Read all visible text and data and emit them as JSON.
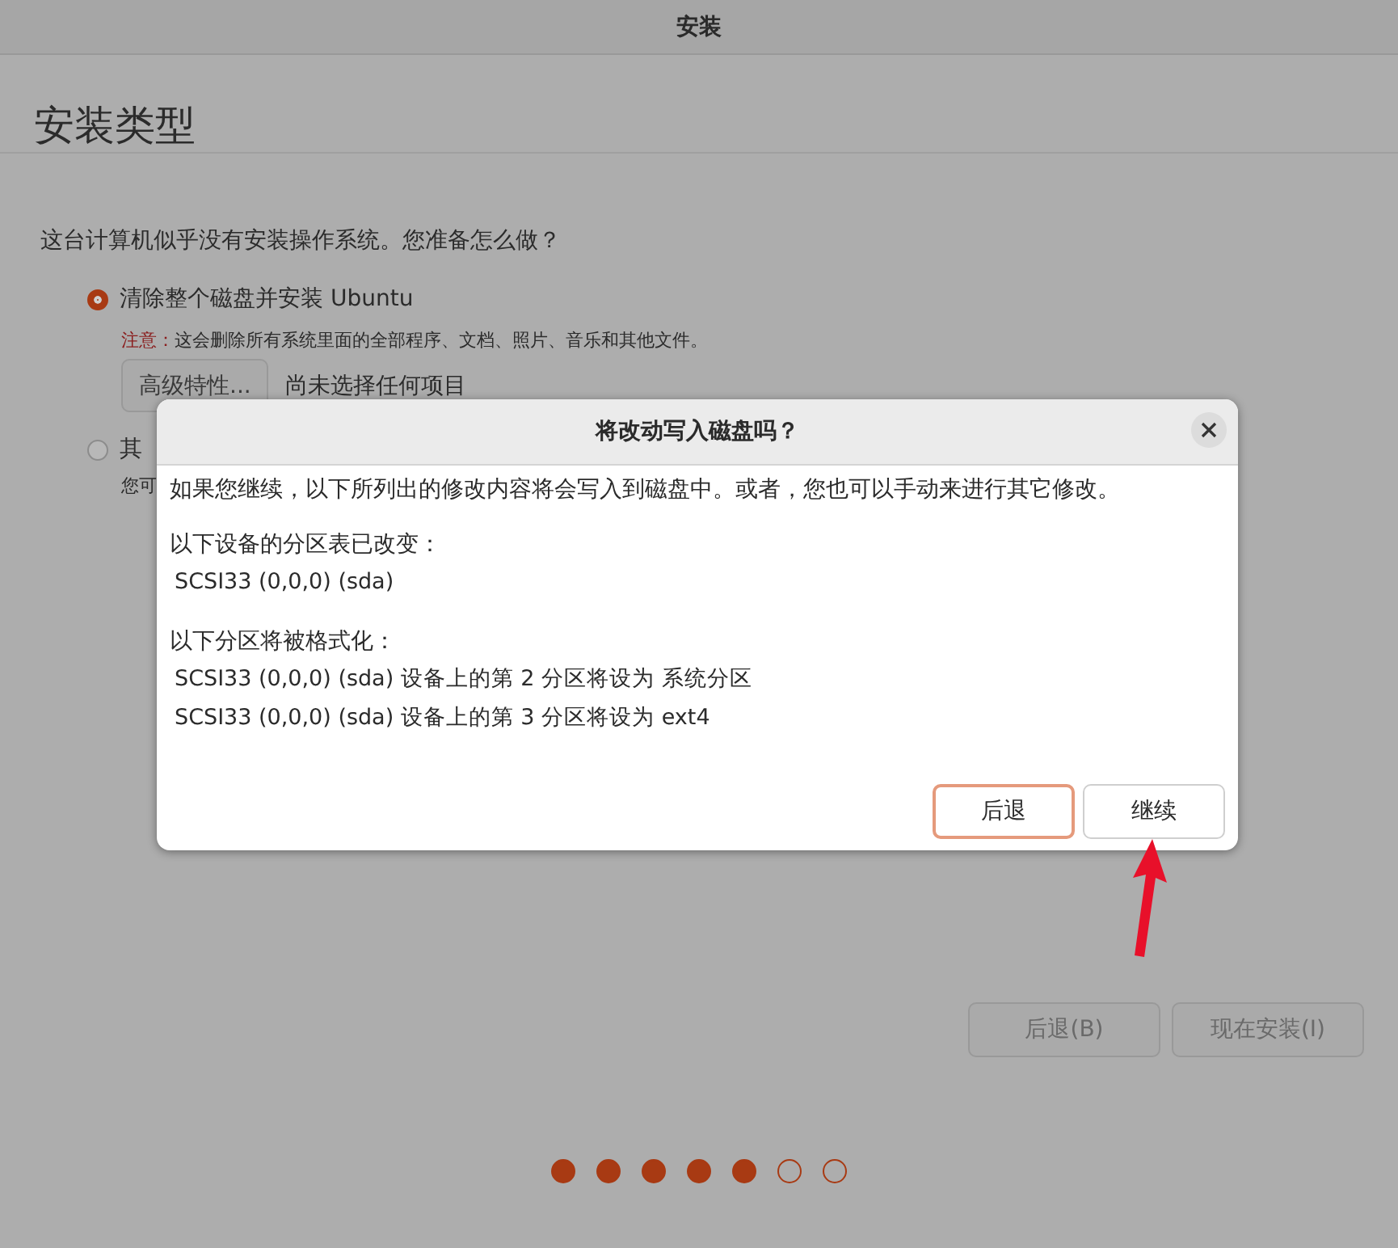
{
  "window": {
    "title": "安装"
  },
  "page": {
    "heading": "安装类型",
    "question": "这台计算机似乎没有安装操作系统。您准备怎么做？",
    "options": [
      {
        "label": "清除整个磁盘并安装 Ubuntu",
        "selected": true,
        "warning_label": "注意：",
        "warning": "这会删除所有系统里面的全部程序、文档、照片、音乐和其他文件。",
        "button": "高级特性...",
        "status": "尚未选择任何项目"
      },
      {
        "label": "其",
        "selected": false,
        "description": "您可"
      }
    ],
    "buttons": [
      {
        "label": "后退(B)"
      },
      {
        "label": "现在安装(I)"
      }
    ],
    "progress": [
      {
        "filled": true
      },
      {
        "filled": true
      },
      {
        "filled": true
      },
      {
        "filled": true
      },
      {
        "filled": true
      },
      {
        "filled": false
      },
      {
        "filled": false
      }
    ]
  },
  "dialog": {
    "title": "将改动写入磁盘吗？",
    "intro": "如果您继续，以下所列出的修改内容将会写入到磁盘中。或者，您也可以手动来进行其它修改。",
    "sections": [
      {
        "heading": "以下设备的分区表已改变：",
        "lines": [
          "SCSI33 (0,0,0) (sda)"
        ]
      },
      {
        "heading": "以下分区将被格式化：",
        "lines": [
          "SCSI33 (0,0,0) (sda) 设备上的第 2 分区将设为 系统分区",
          "SCSI33 (0,0,0) (sda) 设备上的第 3 分区将设为 ext4"
        ]
      }
    ],
    "buttons": [
      {
        "label": "后退",
        "kind": "default"
      },
      {
        "label": "继续",
        "kind": "normal"
      }
    ]
  }
}
